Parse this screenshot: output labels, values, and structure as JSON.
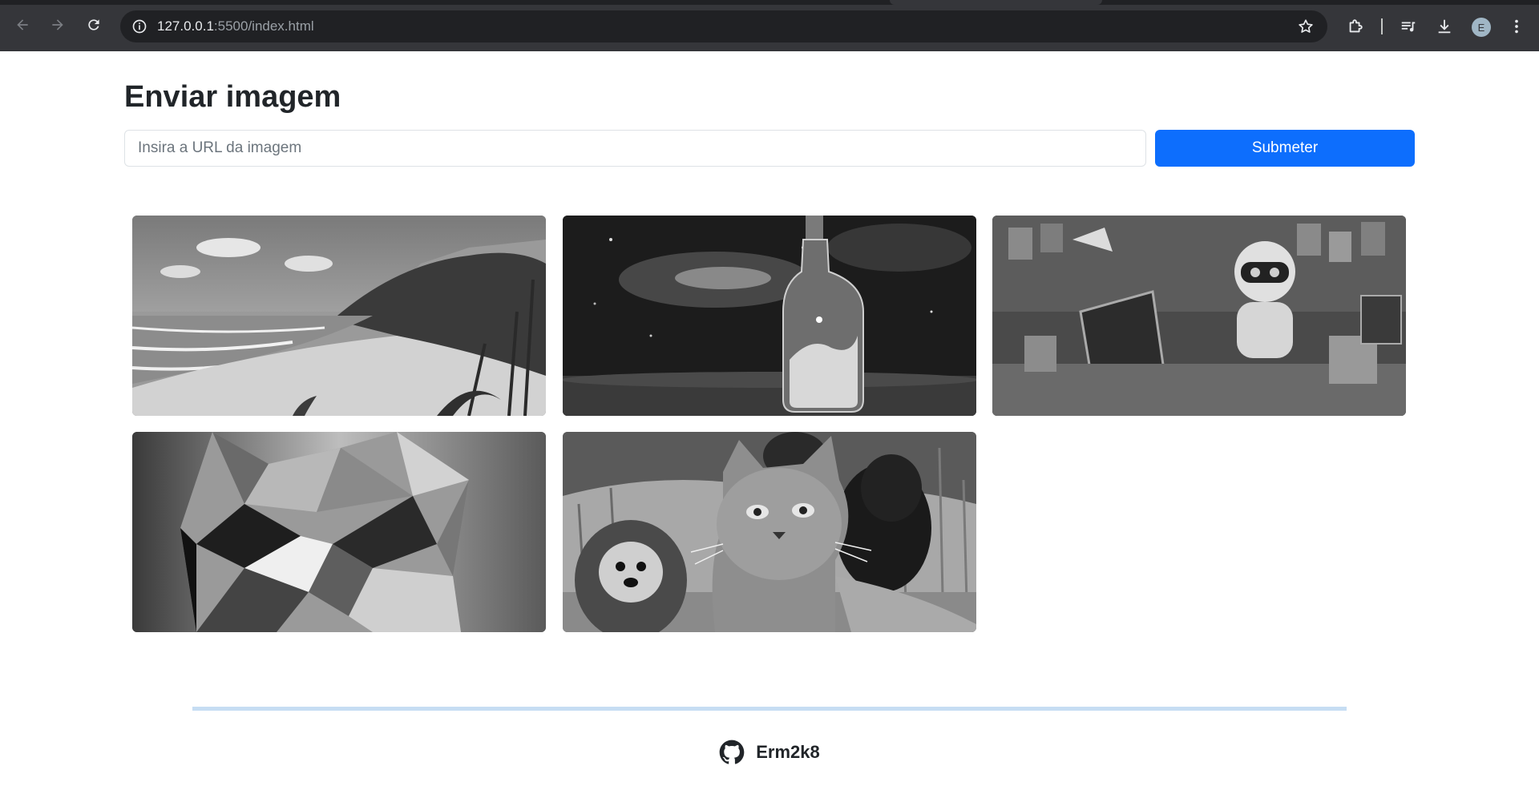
{
  "browser": {
    "url_host": "127.0.0.1",
    "url_rest": ":5500/index.html",
    "avatar_initial": "E"
  },
  "page": {
    "title": "Enviar imagem",
    "input_placeholder": "Insira a URL da imagem",
    "input_value": "",
    "submit_label": "Submeter"
  },
  "gallery": {
    "images": [
      {
        "name": "beach-image"
      },
      {
        "name": "galaxy-bottle-image"
      },
      {
        "name": "robot-artist-image"
      },
      {
        "name": "lowpoly-cat-image"
      },
      {
        "name": "cat-dogs-selfie-image"
      }
    ]
  },
  "footer": {
    "username": "Erm2k8",
    "icon": "github-icon"
  },
  "colors": {
    "accent": "#0d6efd",
    "chrome_bg": "#35363a",
    "footer_rule": "#c6ddf3"
  }
}
